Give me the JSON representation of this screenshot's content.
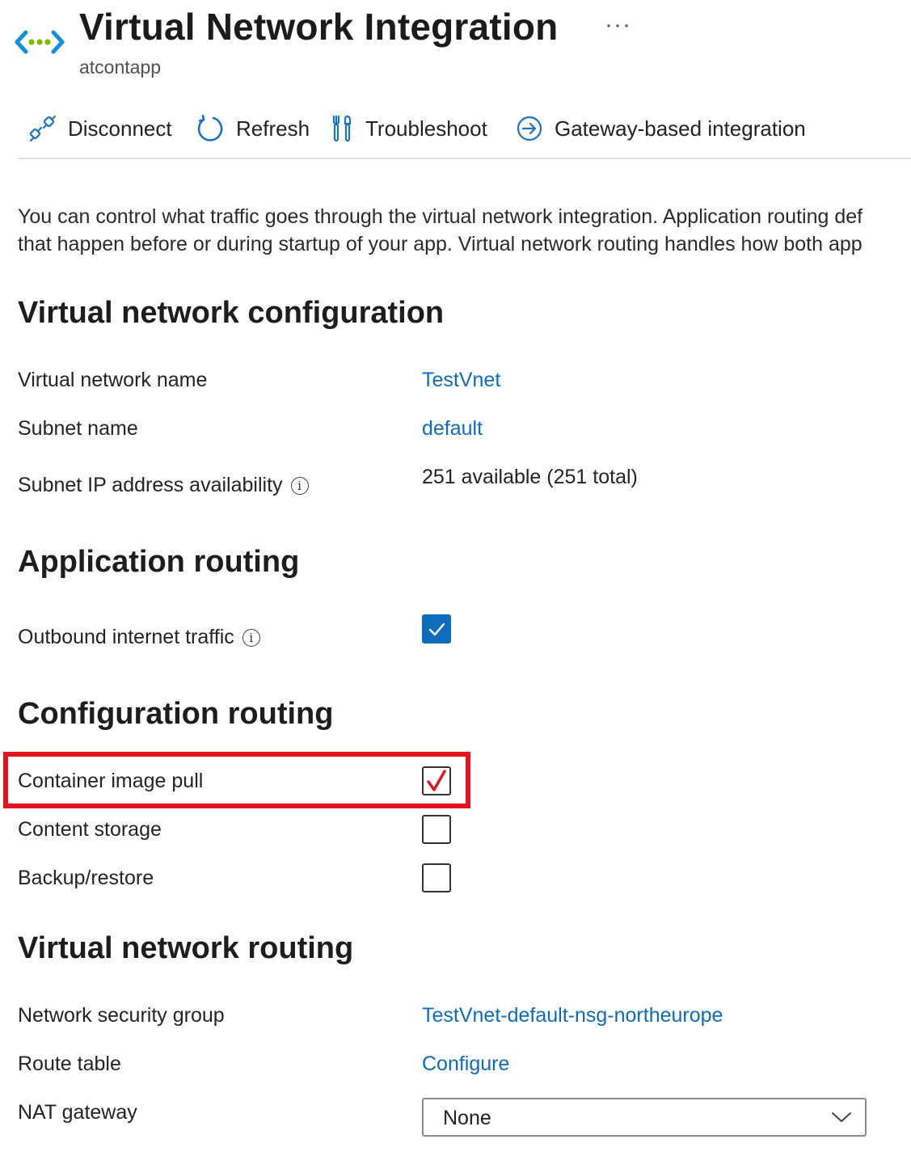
{
  "header": {
    "title": "Virtual Network Integration",
    "subtitle": "atcontapp",
    "more": "···",
    "page_icon": "virtual-network-icon"
  },
  "toolbar": {
    "items": [
      {
        "label": "Disconnect",
        "icon": "disconnect-plug-icon"
      },
      {
        "label": "Refresh",
        "icon": "refresh-icon"
      },
      {
        "label": "Troubleshoot",
        "icon": "troubleshoot-icon"
      },
      {
        "label": "Gateway-based integration",
        "icon": "arrow-circle-right-icon"
      }
    ]
  },
  "description": {
    "line1": "You can control what traffic goes through the virtual network integration. Application routing def",
    "line2": "that happen before or during startup of your app. Virtual network routing handles how both app"
  },
  "vnet_config": {
    "heading": "Virtual network configuration",
    "rows": [
      {
        "label": "Virtual network name",
        "value": "TestVnet"
      },
      {
        "label": "Subnet name",
        "value": "default"
      },
      {
        "label": "Subnet IP address availability",
        "value": "251 available (251 total)"
      }
    ]
  },
  "app_routing": {
    "heading": "Application routing",
    "rows": [
      {
        "label": "Outbound internet traffic",
        "checked": true
      }
    ]
  },
  "config_routing": {
    "heading": "Configuration routing",
    "rows": [
      {
        "label": "Container image pull",
        "checked": true
      },
      {
        "label": "Content storage",
        "checked": false
      },
      {
        "label": "Backup/restore",
        "checked": false
      }
    ]
  },
  "vnet_routing": {
    "heading": "Virtual network routing",
    "rows": [
      {
        "label": "Network security group",
        "value": "TestVnet-default-nsg-northeurope"
      },
      {
        "label": "Route table",
        "value": "Configure"
      },
      {
        "label": "NAT gateway",
        "value": "None"
      }
    ]
  },
  "colors": {
    "link": "#0f6cbd",
    "accent": "#0f6cbd",
    "highlight": "#e3141b",
    "annotation_check": "#e3141b"
  },
  "info_glyph": "i"
}
